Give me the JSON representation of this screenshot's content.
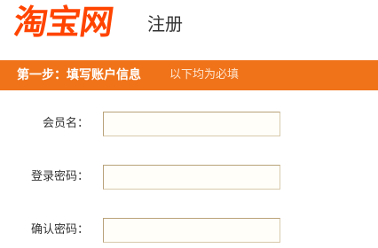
{
  "header": {
    "logo_text": "淘宝网",
    "title": "注册"
  },
  "step_bar": {
    "title": "第一步：填写账户信息",
    "hint": "以下均为必填"
  },
  "form": {
    "fields": [
      {
        "label": "会员名：",
        "value": "",
        "placeholder": ""
      },
      {
        "label": "登录密码：",
        "value": "",
        "placeholder": ""
      },
      {
        "label": "确认密码：",
        "value": "",
        "placeholder": ""
      }
    ]
  },
  "colors": {
    "brand": "#ff4400",
    "step_bar": "#f0731a",
    "input_border": "#b9a27a"
  }
}
